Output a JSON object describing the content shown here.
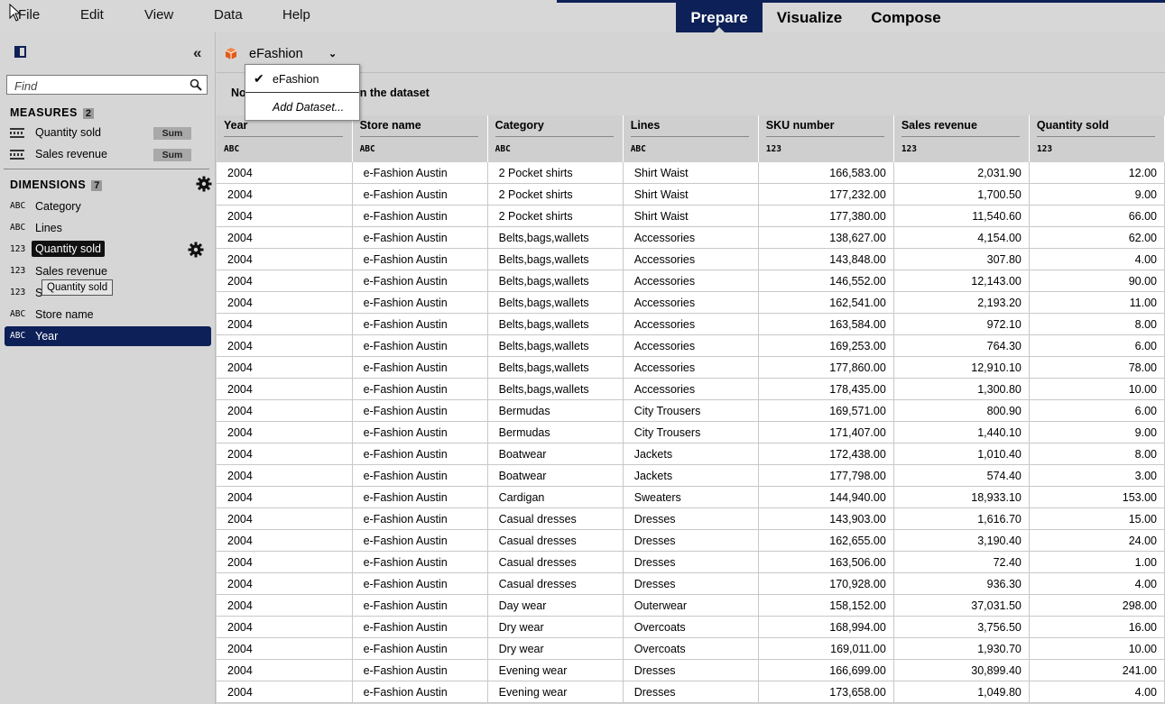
{
  "menu": [
    "File",
    "Edit",
    "View",
    "Data",
    "Help"
  ],
  "modes": [
    {
      "label": "Prepare",
      "active": true
    },
    {
      "label": "Visualize",
      "active": false
    },
    {
      "label": "Compose",
      "active": false
    }
  ],
  "colors": {
    "accent": "#0d2057",
    "panel": "#d6d6d6",
    "dataset_icon": "#e05a1a"
  },
  "left_panel": {
    "find_placeholder": "Find",
    "measures": {
      "title": "MEASURES",
      "count": "2",
      "items": [
        {
          "label": "Quantity sold",
          "agg": "Sum"
        },
        {
          "label": "Sales revenue",
          "agg": "Sum"
        }
      ]
    },
    "dimensions": {
      "title": "DIMENSIONS",
      "count": "7",
      "items": [
        {
          "type": "ABC",
          "label": "Category"
        },
        {
          "type": "ABC",
          "label": "Lines"
        },
        {
          "type": "123",
          "label": "Quantity sold"
        },
        {
          "type": "123",
          "label": "Sales revenue"
        },
        {
          "type": "123",
          "label": "S"
        },
        {
          "type": "ABC",
          "label": "Store name"
        },
        {
          "type": "ABC",
          "label": "Year"
        }
      ]
    },
    "tooltip": "Quantity sold"
  },
  "dataset": {
    "name": "eFashion",
    "info_prefix": "No",
    "info_suffix": "y on the dataset",
    "dropdown": {
      "selected": "eFashion",
      "action": "Add Dataset..."
    }
  },
  "table": {
    "columns": [
      {
        "name": "Year",
        "type": "ABC"
      },
      {
        "name": "Store name",
        "type": "ABC"
      },
      {
        "name": "Category",
        "type": "ABC"
      },
      {
        "name": "Lines",
        "type": "ABC"
      },
      {
        "name": "SKU number",
        "type": "123"
      },
      {
        "name": "Sales revenue",
        "type": "123"
      },
      {
        "name": "Quantity sold",
        "type": "123"
      }
    ],
    "rows": [
      [
        "2004",
        "e-Fashion Austin",
        "2 Pocket shirts",
        "Shirt Waist",
        "166,583.00",
        "2,031.90",
        "12.00"
      ],
      [
        "2004",
        "e-Fashion Austin",
        "2 Pocket shirts",
        "Shirt Waist",
        "177,232.00",
        "1,700.50",
        "9.00"
      ],
      [
        "2004",
        "e-Fashion Austin",
        "2 Pocket shirts",
        "Shirt Waist",
        "177,380.00",
        "11,540.60",
        "66.00"
      ],
      [
        "2004",
        "e-Fashion Austin",
        "Belts,bags,wallets",
        "Accessories",
        "138,627.00",
        "4,154.00",
        "62.00"
      ],
      [
        "2004",
        "e-Fashion Austin",
        "Belts,bags,wallets",
        "Accessories",
        "143,848.00",
        "307.80",
        "4.00"
      ],
      [
        "2004",
        "e-Fashion Austin",
        "Belts,bags,wallets",
        "Accessories",
        "146,552.00",
        "12,143.00",
        "90.00"
      ],
      [
        "2004",
        "e-Fashion Austin",
        "Belts,bags,wallets",
        "Accessories",
        "162,541.00",
        "2,193.20",
        "11.00"
      ],
      [
        "2004",
        "e-Fashion Austin",
        "Belts,bags,wallets",
        "Accessories",
        "163,584.00",
        "972.10",
        "8.00"
      ],
      [
        "2004",
        "e-Fashion Austin",
        "Belts,bags,wallets",
        "Accessories",
        "169,253.00",
        "764.30",
        "6.00"
      ],
      [
        "2004",
        "e-Fashion Austin",
        "Belts,bags,wallets",
        "Accessories",
        "177,860.00",
        "12,910.10",
        "78.00"
      ],
      [
        "2004",
        "e-Fashion Austin",
        "Belts,bags,wallets",
        "Accessories",
        "178,435.00",
        "1,300.80",
        "10.00"
      ],
      [
        "2004",
        "e-Fashion Austin",
        "Bermudas",
        "City Trousers",
        "169,571.00",
        "800.90",
        "6.00"
      ],
      [
        "2004",
        "e-Fashion Austin",
        "Bermudas",
        "City Trousers",
        "171,407.00",
        "1,440.10",
        "9.00"
      ],
      [
        "2004",
        "e-Fashion Austin",
        "Boatwear",
        "Jackets",
        "172,438.00",
        "1,010.40",
        "8.00"
      ],
      [
        "2004",
        "e-Fashion Austin",
        "Boatwear",
        "Jackets",
        "177,798.00",
        "574.40",
        "3.00"
      ],
      [
        "2004",
        "e-Fashion Austin",
        "Cardigan",
        "Sweaters",
        "144,940.00",
        "18,933.10",
        "153.00"
      ],
      [
        "2004",
        "e-Fashion Austin",
        "Casual dresses",
        "Dresses",
        "143,903.00",
        "1,616.70",
        "15.00"
      ],
      [
        "2004",
        "e-Fashion Austin",
        "Casual dresses",
        "Dresses",
        "162,655.00",
        "3,190.40",
        "24.00"
      ],
      [
        "2004",
        "e-Fashion Austin",
        "Casual dresses",
        "Dresses",
        "163,506.00",
        "72.40",
        "1.00"
      ],
      [
        "2004",
        "e-Fashion Austin",
        "Casual dresses",
        "Dresses",
        "170,928.00",
        "936.30",
        "4.00"
      ],
      [
        "2004",
        "e-Fashion Austin",
        "Day wear",
        "Outerwear",
        "158,152.00",
        "37,031.50",
        "298.00"
      ],
      [
        "2004",
        "e-Fashion Austin",
        "Dry wear",
        "Overcoats",
        "168,994.00",
        "3,756.50",
        "16.00"
      ],
      [
        "2004",
        "e-Fashion Austin",
        "Dry wear",
        "Overcoats",
        "169,011.00",
        "1,930.70",
        "10.00"
      ],
      [
        "2004",
        "e-Fashion Austin",
        "Evening wear",
        "Dresses",
        "166,699.00",
        "30,899.40",
        "241.00"
      ],
      [
        "2004",
        "e-Fashion Austin",
        "Evening wear",
        "Dresses",
        "173,658.00",
        "1,049.80",
        "4.00"
      ]
    ]
  }
}
